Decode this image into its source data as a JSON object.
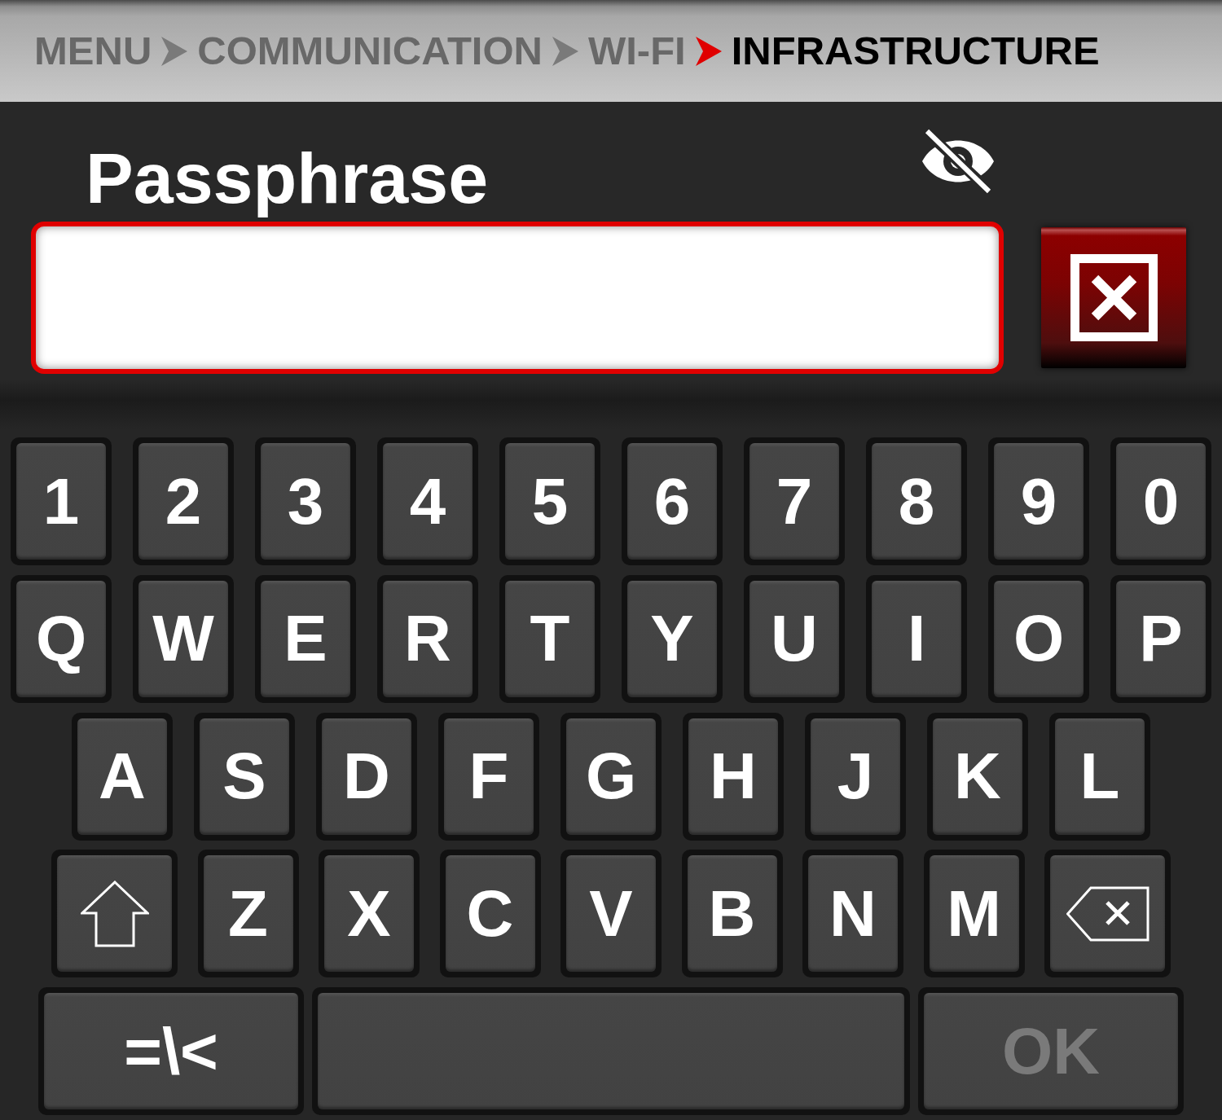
{
  "breadcrumb": [
    {
      "label": "MENU",
      "current": false
    },
    {
      "label": "COMMUNICATION",
      "current": false
    },
    {
      "label": "WI-FI",
      "current": false
    },
    {
      "label": "INFRASTRUCTURE",
      "current": true
    }
  ],
  "title": "Passphrase",
  "visibility_toggle": {
    "masked": true
  },
  "passphrase_field": {
    "focused": true
  },
  "keyboard": {
    "rows": [
      [
        {
          "kind": "char",
          "label": "1",
          "disabled": false
        },
        {
          "kind": "char",
          "label": "2",
          "disabled": false
        },
        {
          "kind": "char",
          "label": "3",
          "disabled": false
        },
        {
          "kind": "char",
          "label": "4",
          "disabled": false
        },
        {
          "kind": "char",
          "label": "5",
          "disabled": false
        },
        {
          "kind": "char",
          "label": "6",
          "disabled": false
        },
        {
          "kind": "char",
          "label": "7",
          "disabled": false
        },
        {
          "kind": "char",
          "label": "8",
          "disabled": false
        },
        {
          "kind": "char",
          "label": "9",
          "disabled": false
        },
        {
          "kind": "char",
          "label": "0",
          "disabled": false
        }
      ],
      [
        {
          "kind": "char",
          "label": "Q",
          "disabled": false
        },
        {
          "kind": "char",
          "label": "W",
          "disabled": false
        },
        {
          "kind": "char",
          "label": "E",
          "disabled": false
        },
        {
          "kind": "char",
          "label": "R",
          "disabled": false
        },
        {
          "kind": "char",
          "label": "T",
          "disabled": false
        },
        {
          "kind": "char",
          "label": "Y",
          "disabled": false
        },
        {
          "kind": "char",
          "label": "U",
          "disabled": false
        },
        {
          "kind": "char",
          "label": "I",
          "disabled": false
        },
        {
          "kind": "char",
          "label": "O",
          "disabled": false
        },
        {
          "kind": "char",
          "label": "P",
          "disabled": false
        }
      ],
      [
        {
          "kind": "char",
          "label": "A",
          "disabled": false
        },
        {
          "kind": "char",
          "label": "S",
          "disabled": false
        },
        {
          "kind": "char",
          "label": "D",
          "disabled": false
        },
        {
          "kind": "char",
          "label": "F",
          "disabled": false
        },
        {
          "kind": "char",
          "label": "G",
          "disabled": false
        },
        {
          "kind": "char",
          "label": "H",
          "disabled": false
        },
        {
          "kind": "char",
          "label": "J",
          "disabled": false
        },
        {
          "kind": "char",
          "label": "K",
          "disabled": false
        },
        {
          "kind": "char",
          "label": "L",
          "disabled": false
        }
      ],
      [
        {
          "kind": "shift",
          "disabled": false
        },
        {
          "kind": "char",
          "label": "Z",
          "disabled": false
        },
        {
          "kind": "char",
          "label": "X",
          "disabled": false
        },
        {
          "kind": "char",
          "label": "C",
          "disabled": false
        },
        {
          "kind": "char",
          "label": "V",
          "disabled": false
        },
        {
          "kind": "char",
          "label": "B",
          "disabled": false
        },
        {
          "kind": "char",
          "label": "N",
          "disabled": false
        },
        {
          "kind": "char",
          "label": "M",
          "disabled": false
        },
        {
          "kind": "backspace",
          "disabled": false
        }
      ]
    ],
    "bottom_row": [
      {
        "kind": "symbols",
        "label": "=\\<",
        "disabled": false
      },
      {
        "kind": "space"
      },
      {
        "kind": "ok",
        "label": "OK",
        "disabled": true
      }
    ]
  }
}
